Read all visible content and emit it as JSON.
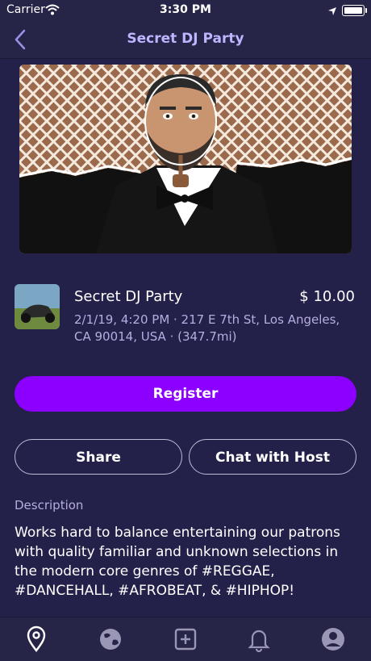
{
  "status_bar": {
    "carrier": "Carrier",
    "time": "3:30 PM"
  },
  "nav": {
    "title": "Secret DJ Party"
  },
  "event": {
    "name": "Secret DJ Party",
    "price": "$ 10.00",
    "details": "2/1/19, 4:20 PM · 217 E 7th St, Los Angeles, CA 90014, USA · (347.7mi)"
  },
  "actions": {
    "register": "Register",
    "share": "Share",
    "chat": "Chat with Host"
  },
  "description": {
    "label": "Description",
    "text": "Works hard to balance entertaining our patrons with quality familiar and unknown selections in the modern core genres of #REGGAE, #DANCEHALL, #AFROBEAT, & #HIPHOP!"
  },
  "tabbar": {
    "items": [
      "location-pin-icon",
      "globe-icon",
      "add-icon",
      "bell-icon",
      "profile-icon"
    ],
    "active_color": "#ffffff",
    "inactive_color": "#9a96b6"
  },
  "colors": {
    "background": "#232149",
    "nav_title": "#bcb6ff",
    "accent": "#8b00ff",
    "muted_text": "#b4aee2"
  }
}
